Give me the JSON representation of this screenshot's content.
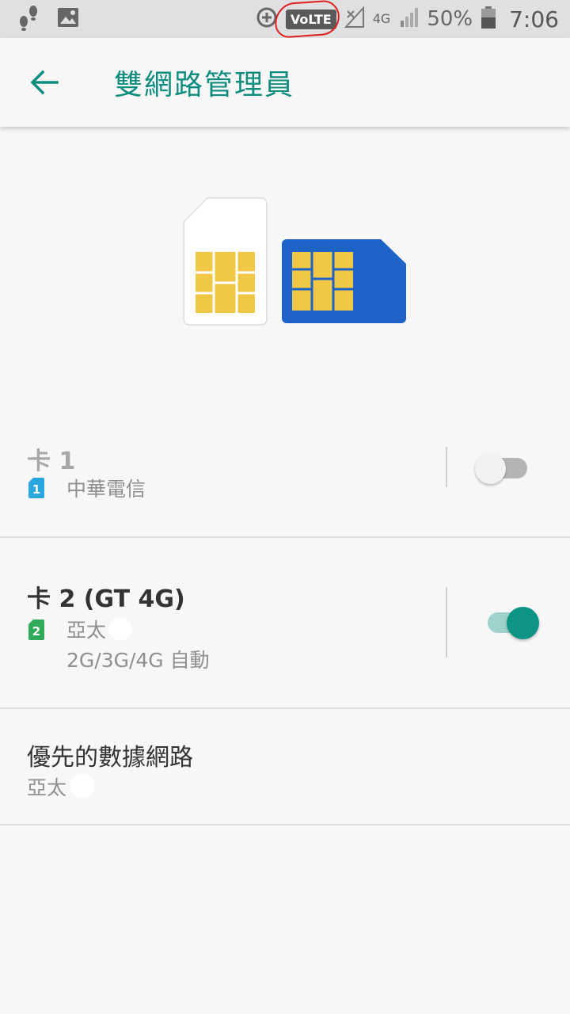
{
  "status_bar": {
    "volte": "VoLTE",
    "network": "4G",
    "battery": "50%",
    "time": "7:06"
  },
  "toolbar": {
    "title": "雙網路管理員"
  },
  "sim1": {
    "title": "卡 1",
    "slot_number": "1",
    "carrier": "中華電信",
    "enabled": false,
    "icon_color": "#29a8e0"
  },
  "sim2": {
    "title": "卡 2 (GT 4G)",
    "slot_number": "2",
    "carrier": "亞太",
    "mode": "2G/3G/4G 自動",
    "enabled": true,
    "icon_color": "#2eaa5a"
  },
  "preferred": {
    "title": "優先的數據網路",
    "value": "亞太"
  },
  "colors": {
    "accent": "#0e8c7f",
    "sim_white": "#ffffff",
    "sim_blue": "#1e64c8",
    "chip": "#f0c846"
  }
}
